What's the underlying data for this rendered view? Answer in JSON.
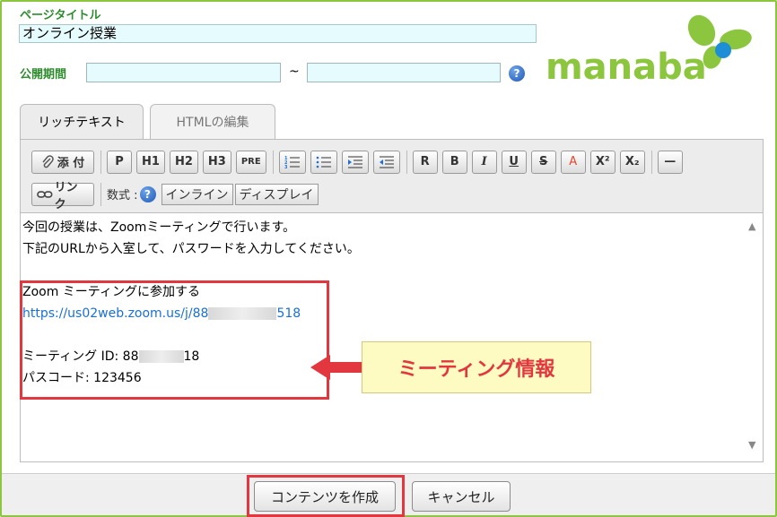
{
  "page_title": {
    "label": "ページタイトル",
    "value": "オンライン授業"
  },
  "period": {
    "label": "公開期間",
    "separator": "~",
    "start_value": "",
    "end_value": ""
  },
  "help_glyph": "?",
  "logo": {
    "text": "manaba",
    "color": "#8cc63f",
    "accent": "#1e8fd6"
  },
  "tabs": [
    {
      "label": "リッチテキスト",
      "active": true
    },
    {
      "label": "HTMLの編集",
      "active": false
    }
  ],
  "toolbar": {
    "attach": "添 付",
    "p": "P",
    "h1": "H1",
    "h2": "H2",
    "h3": "H3",
    "pre": "PRE",
    "r": "R",
    "b": "B",
    "i": "I",
    "u": "U",
    "s": "S",
    "a": "A",
    "sup": "X²",
    "sub": "X₂",
    "hr": "—",
    "link": "リンク",
    "math_label": "数式 :",
    "inline": "インライン",
    "display": "ディスプレイ"
  },
  "content": {
    "line1": "今回の授業は、Zoomミーティングで行います。",
    "line2": "下記のURLから入室して、パスワードを入力してください。",
    "line3": "Zoom ミーティングに参加する",
    "link_prefix": "https://us02web.zoom.us/j/88",
    "link_suffix": "518",
    "meeting_id_prefix": "ミーティング ID: 88",
    "meeting_id_suffix": "18",
    "passcode": "パスコード: 123456"
  },
  "callout": "ミーティング情報",
  "footer": {
    "create": "コンテンツを作成",
    "cancel": "キャンセル"
  },
  "colors": {
    "frame": "#8cc63f",
    "label_green": "#2e8b2e",
    "highlight_red": "#e2373f",
    "callout_bg": "#fdfbc2",
    "link": "#1a6fd1"
  }
}
